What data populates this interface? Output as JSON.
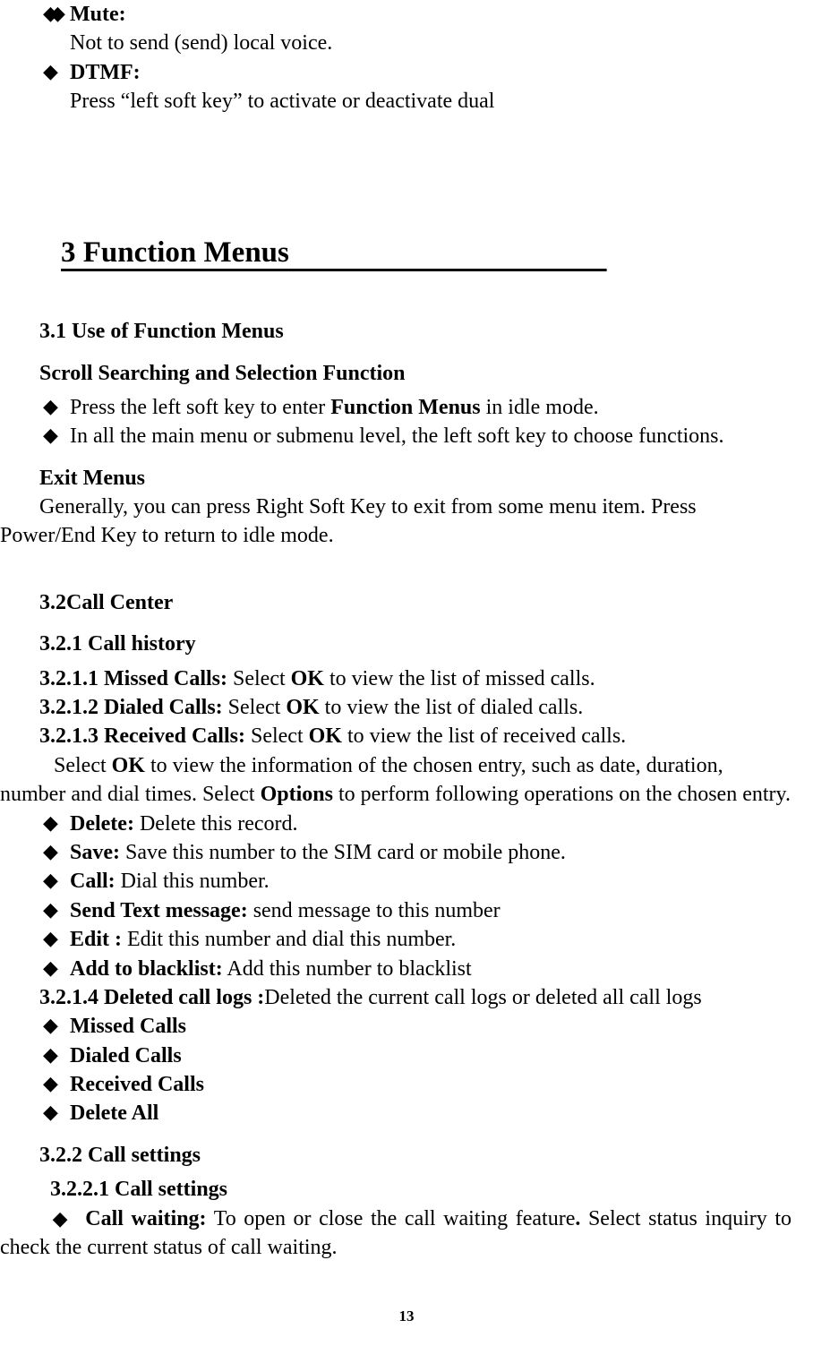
{
  "top_bullets": [
    {
      "label": "Mute:",
      "desc": "Not to send (send) local voice."
    },
    {
      "label": "DTMF:",
      "desc": "Press “left soft key” to activate or deactivate dual"
    }
  ],
  "section_title": "3 Function Menus",
  "sec31_heading": "3.1 Use of Function Menus",
  "scroll_heading": "Scroll Searching and Selection Function",
  "scroll_b1_a": "Press the left soft key to enter ",
  "scroll_b1_bold": "Function Menus",
  "scroll_b1_b": " in idle mode.",
  "scroll_b2": "In all the main menu or submenu level, the left soft key to choose functions.",
  "exit_heading": "Exit Menus",
  "exit_para": "Generally, you can press Right Soft Key to exit from some menu item. Press Power/End Key to return to idle mode.",
  "sec32_heading": "3.2Call Center",
  "sec321_heading": "3.2.1 Call history",
  "line_3211": {
    "bold": "3.2.1.1 Missed Calls: ",
    "a": "Select ",
    "ok": "OK",
    "b": " to view the list of missed calls."
  },
  "line_3212": {
    "bold": "3.2.1.2 Dialed Calls: ",
    "a": "Select ",
    "ok": "OK",
    "b": " to view the list of dialed calls."
  },
  "line_3213": {
    "bold": "3.2.1.3 Received Calls: ",
    "a": "Select ",
    "ok": "OK",
    "b": " to view the list of received calls."
  },
  "para_select": {
    "a": "Select ",
    "ok": "OK",
    "b": " to view the information of the chosen entry, such as date, duration, number and dial times. Select ",
    "opt": "Options",
    "c": " to perform following operations on the chosen entry."
  },
  "ops": [
    {
      "label": "Delete:",
      "desc": " Delete this record."
    },
    {
      "label": "Save:",
      "desc": " Save this number to the SIM card or mobile phone."
    },
    {
      "label": "Call:",
      "desc": " Dial this number."
    },
    {
      "label": "Send Text message:",
      "desc": " send message to this number"
    },
    {
      "label": "Edit :",
      "desc": " Edit this number and dial this number."
    },
    {
      "label": "Add to blacklist:",
      "desc": " Add this number to blacklist"
    }
  ],
  "line_3214": {
    "bold": "3.2.1.4 Deleted call logs :",
    "rest": "Deleted the current call logs or deleted all call logs"
  },
  "del_bullets": [
    "Missed Calls",
    "Dialed Calls",
    "Received Calls",
    "Delete All"
  ],
  "sec322_heading": "3.2.2 Call settings",
  "sec3221_heading": "3.2.2.1 Call settings",
  "call_waiting": {
    "label": "Call waiting:",
    "a": " To open or close the call waiting feature",
    "dot": ". ",
    "b": "Select status inquiry to check the current status of call waiting."
  },
  "page_number": "13"
}
